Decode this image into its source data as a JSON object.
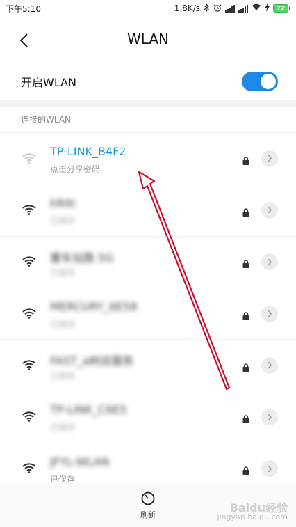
{
  "status_bar": {
    "time": "下午5:10",
    "net_speed": "1.8K/s",
    "battery": "72"
  },
  "header": {
    "title": "WLAN"
  },
  "toggle": {
    "label": "开启WLAN",
    "on": true
  },
  "section": {
    "title": "连接的WLAN"
  },
  "networks": [
    {
      "name": "TP-LINK_B4F2",
      "status": "点击分享密码",
      "active": true,
      "blurred": false
    },
    {
      "name": "k8dc",
      "status": "已保存",
      "active": false,
      "blurred": true
    },
    {
      "name": "董车站路 5G",
      "status": "已保存",
      "active": false,
      "blurred": true
    },
    {
      "name": "MERCURY_6E58",
      "status": "已保存",
      "active": false,
      "blurred": true
    },
    {
      "name": "FAST_a树店服务",
      "status": "已保存",
      "active": false,
      "blurred": true
    },
    {
      "name": "TP-LINK_C6E5",
      "status": "已保存",
      "active": false,
      "blurred": true
    },
    {
      "name": "JFYL-WLAN",
      "status": "已保存",
      "active": false,
      "blurred": true
    }
  ],
  "bottom": {
    "refresh_label": "刷新"
  },
  "watermark": {
    "title": "Baidu经验",
    "url": "jingyan.baidu.com"
  },
  "colors": {
    "accent": "#1e88e5",
    "active_name": "#1e9bd3",
    "arrow": "#c8102e"
  }
}
